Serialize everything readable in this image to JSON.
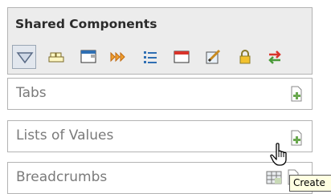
{
  "shared_components": {
    "title": "Shared Components",
    "toolbar": [
      {
        "icon": "dropdown-arrow-icon",
        "selected": true
      },
      {
        "icon": "tabs-icon"
      },
      {
        "icon": "list-of-values-icon"
      },
      {
        "icon": "breadcrumb-arrows-icon"
      },
      {
        "icon": "list-icon"
      },
      {
        "icon": "template-icon"
      },
      {
        "icon": "theme-brush-icon"
      },
      {
        "icon": "lock-icon"
      },
      {
        "icon": "swap-arrows-icon"
      }
    ]
  },
  "regions": [
    {
      "label": "Tabs",
      "icons": [
        "create-icon"
      ]
    },
    {
      "label": "Lists of Values",
      "icons": [
        "create-icon"
      ]
    },
    {
      "label": "Breadcrumbs",
      "icons": [
        "grid-icon",
        "create-icon"
      ]
    }
  ],
  "tooltip": {
    "text": "Create"
  },
  "colors": {
    "panel_bg": "#ececec",
    "border": "#b3b3b3",
    "tooltip_bg": "#ffffe1",
    "create_icon": "#6aa84f"
  }
}
